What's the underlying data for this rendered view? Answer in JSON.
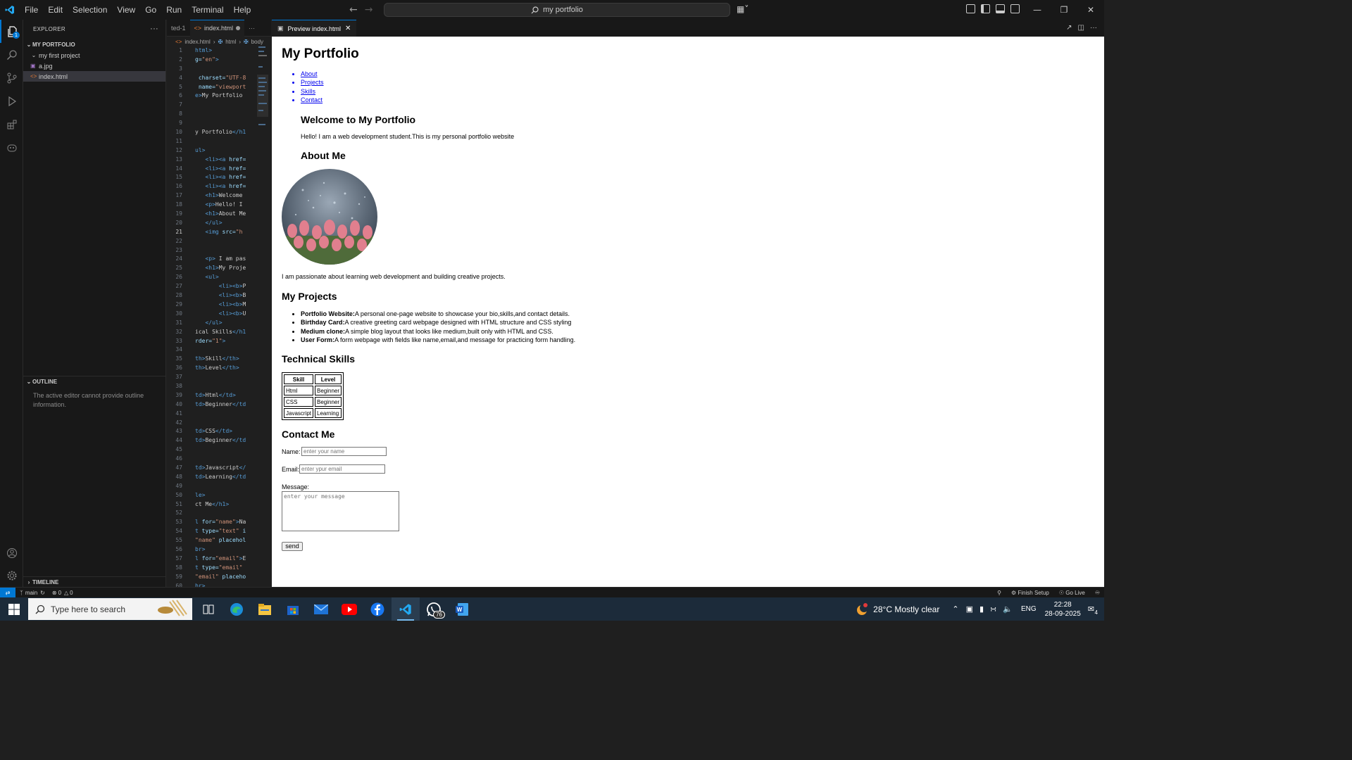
{
  "titlebar": {
    "menu": [
      "File",
      "Edit",
      "Selection",
      "View",
      "Go",
      "Run",
      "Terminal",
      "Help"
    ],
    "search_text": "my portfolio"
  },
  "activity": {
    "explorer_badge": "1"
  },
  "sidebar": {
    "header": "EXPLORER",
    "root": "MY PORTFOLIO",
    "items": [
      {
        "label": "my first project",
        "type": "folder"
      },
      {
        "label": "a.jpg",
        "type": "image"
      },
      {
        "label": "index.html",
        "type": "html"
      }
    ],
    "outline_header": "OUTLINE",
    "outline_message": "The active editor cannot provide outline information.",
    "timeline_header": "TIMELINE"
  },
  "editor": {
    "tabs": [
      {
        "label": "ted-1"
      },
      {
        "label": "index.html"
      }
    ],
    "breadcrumb": [
      "index.html",
      "html",
      "body"
    ],
    "current_line": 21,
    "lines": [
      {
        "n": 1,
        "parts": [
          [
            "tag",
            "html>"
          ]
        ]
      },
      {
        "n": 2,
        "parts": [
          [
            "attr",
            "g="
          ],
          [
            "str",
            "\"en\""
          ],
          [
            "tag",
            ">"
          ]
        ]
      },
      {
        "n": 3,
        "parts": []
      },
      {
        "n": 4,
        "parts": [
          [
            "attr",
            " charset="
          ],
          [
            "str",
            "\"UTF-8"
          ]
        ]
      },
      {
        "n": 5,
        "parts": [
          [
            "attr",
            " name="
          ],
          [
            "str",
            "\"viewport"
          ]
        ]
      },
      {
        "n": 6,
        "parts": [
          [
            "tag",
            "e>"
          ],
          [
            "txt",
            "My Portfolio"
          ]
        ]
      },
      {
        "n": 7,
        "parts": []
      },
      {
        "n": 8,
        "parts": []
      },
      {
        "n": 9,
        "parts": []
      },
      {
        "n": 10,
        "parts": [
          [
            "txt",
            "y Portfolio"
          ],
          [
            "tag",
            "</h1"
          ]
        ]
      },
      {
        "n": 11,
        "parts": []
      },
      {
        "n": 12,
        "parts": [
          [
            "tag",
            "ul>"
          ]
        ]
      },
      {
        "n": 13,
        "parts": [
          [
            "tag",
            "   <li><a "
          ],
          [
            "attr",
            "href="
          ]
        ]
      },
      {
        "n": 14,
        "parts": [
          [
            "tag",
            "   <li><a "
          ],
          [
            "attr",
            "href="
          ]
        ]
      },
      {
        "n": 15,
        "parts": [
          [
            "tag",
            "   <li><a "
          ],
          [
            "attr",
            "href="
          ]
        ]
      },
      {
        "n": 16,
        "parts": [
          [
            "tag",
            "   <li><a "
          ],
          [
            "attr",
            "href="
          ]
        ]
      },
      {
        "n": 17,
        "parts": [
          [
            "tag",
            "   <h1>"
          ],
          [
            "txt",
            "Welcome"
          ]
        ]
      },
      {
        "n": 18,
        "parts": [
          [
            "tag",
            "   <p>"
          ],
          [
            "txt",
            "Hello! I"
          ]
        ]
      },
      {
        "n": 19,
        "parts": [
          [
            "tag",
            "   <h1>"
          ],
          [
            "txt",
            "About Me"
          ]
        ]
      },
      {
        "n": 20,
        "parts": [
          [
            "tag",
            "   </ul>"
          ]
        ]
      },
      {
        "n": 21,
        "parts": [
          [
            "tag",
            "   <img "
          ],
          [
            "attr",
            "src="
          ],
          [
            "str",
            "\"h"
          ]
        ]
      },
      {
        "n": 22,
        "parts": []
      },
      {
        "n": 23,
        "parts": []
      },
      {
        "n": 24,
        "parts": [
          [
            "tag",
            "   <p>"
          ],
          [
            "txt",
            " I am pas"
          ]
        ]
      },
      {
        "n": 25,
        "parts": [
          [
            "tag",
            "   <h1>"
          ],
          [
            "txt",
            "My Proje"
          ]
        ]
      },
      {
        "n": 26,
        "parts": [
          [
            "tag",
            "   <ul>"
          ]
        ]
      },
      {
        "n": 27,
        "parts": [
          [
            "tag",
            "       <li><b>"
          ],
          [
            "txt",
            "P"
          ]
        ]
      },
      {
        "n": 28,
        "parts": [
          [
            "tag",
            "       <li><b>"
          ],
          [
            "txt",
            "B"
          ]
        ]
      },
      {
        "n": 29,
        "parts": [
          [
            "tag",
            "       <li><b>"
          ],
          [
            "txt",
            "M"
          ]
        ]
      },
      {
        "n": 30,
        "parts": [
          [
            "tag",
            "       <li><b>"
          ],
          [
            "txt",
            "U"
          ]
        ]
      },
      {
        "n": 31,
        "parts": [
          [
            "tag",
            "   </ul>"
          ]
        ]
      },
      {
        "n": 32,
        "parts": [
          [
            "txt",
            "ical Skills"
          ],
          [
            "tag",
            "</h1"
          ]
        ]
      },
      {
        "n": 33,
        "parts": [
          [
            "attr",
            "rder="
          ],
          [
            "str",
            "\"1\""
          ],
          [
            "tag",
            ">"
          ]
        ]
      },
      {
        "n": 34,
        "parts": []
      },
      {
        "n": 35,
        "parts": [
          [
            "tag",
            "th>"
          ],
          [
            "txt",
            "Skill"
          ],
          [
            "tag",
            "</th>"
          ]
        ]
      },
      {
        "n": 36,
        "parts": [
          [
            "tag",
            "th>"
          ],
          [
            "txt",
            "Level"
          ],
          [
            "tag",
            "</th>"
          ]
        ]
      },
      {
        "n": 37,
        "parts": []
      },
      {
        "n": 38,
        "parts": []
      },
      {
        "n": 39,
        "parts": [
          [
            "tag",
            "td>"
          ],
          [
            "txt",
            "Html"
          ],
          [
            "tag",
            "</td>"
          ]
        ]
      },
      {
        "n": 40,
        "parts": [
          [
            "tag",
            "td>"
          ],
          [
            "txt",
            "Beginner"
          ],
          [
            "tag",
            "</td"
          ]
        ]
      },
      {
        "n": 41,
        "parts": []
      },
      {
        "n": 42,
        "parts": []
      },
      {
        "n": 43,
        "parts": [
          [
            "tag",
            "td>"
          ],
          [
            "txt",
            "CSS"
          ],
          [
            "tag",
            "</td>"
          ]
        ]
      },
      {
        "n": 44,
        "parts": [
          [
            "tag",
            "td>"
          ],
          [
            "txt",
            "Beginner"
          ],
          [
            "tag",
            "</td"
          ]
        ]
      },
      {
        "n": 45,
        "parts": []
      },
      {
        "n": 46,
        "parts": []
      },
      {
        "n": 47,
        "parts": [
          [
            "tag",
            "td>"
          ],
          [
            "txt",
            "Javascript"
          ],
          [
            "tag",
            "</"
          ]
        ]
      },
      {
        "n": 48,
        "parts": [
          [
            "tag",
            "td>"
          ],
          [
            "txt",
            "Learning"
          ],
          [
            "tag",
            "</td"
          ]
        ]
      },
      {
        "n": 49,
        "parts": []
      },
      {
        "n": 50,
        "parts": [
          [
            "tag",
            "le>"
          ]
        ]
      },
      {
        "n": 51,
        "parts": [
          [
            "txt",
            "ct Me"
          ],
          [
            "tag",
            "</h1>"
          ]
        ]
      },
      {
        "n": 52,
        "parts": []
      },
      {
        "n": 53,
        "parts": [
          [
            "tag",
            "l "
          ],
          [
            "attr",
            "for="
          ],
          [
            "str",
            "\"name\""
          ],
          [
            "tag",
            ">"
          ],
          [
            "txt",
            "Na"
          ]
        ]
      },
      {
        "n": 54,
        "parts": [
          [
            "tag",
            "t "
          ],
          [
            "attr",
            "type="
          ],
          [
            "str",
            "\"text\""
          ],
          [
            "attr",
            " i"
          ]
        ]
      },
      {
        "n": 55,
        "parts": [
          [
            "str",
            "\"name\""
          ],
          [
            "attr",
            " placehol"
          ]
        ]
      },
      {
        "n": 56,
        "parts": [
          [
            "tag",
            "br>"
          ]
        ]
      },
      {
        "n": 57,
        "parts": [
          [
            "tag",
            "l "
          ],
          [
            "attr",
            "for="
          ],
          [
            "str",
            "\"email\""
          ],
          [
            "tag",
            ">"
          ],
          [
            "txt",
            "E"
          ]
        ]
      },
      {
        "n": 58,
        "parts": [
          [
            "tag",
            "t "
          ],
          [
            "attr",
            "type="
          ],
          [
            "str",
            "\"email\""
          ]
        ]
      },
      {
        "n": 59,
        "parts": [
          [
            "str",
            "\"email\""
          ],
          [
            "attr",
            " placeho"
          ]
        ]
      },
      {
        "n": 60,
        "parts": [
          [
            "tag",
            "br>"
          ]
        ]
      }
    ]
  },
  "preview": {
    "tab_label": "Preview index.html",
    "title": "My Portfolio",
    "nav": [
      "About",
      "Projects",
      "Skills",
      "Contact"
    ],
    "welcome_heading": "Welcome to My Portfolio",
    "welcome_text": "Hello! I am a web development student.This is my personal portfolio website",
    "about_heading": "About Me",
    "about_text": "I am passionate about learning web development and building creative projects.",
    "projects_heading": "My Projects",
    "projects": [
      {
        "name": "Portfolio Website:",
        "desc": "A personal one-page website to showcase your bio,skills,and contact details."
      },
      {
        "name": "Birthday Card:",
        "desc": "A creative greeting card webpage designed with HTML structure and CSS styling"
      },
      {
        "name": "Medium clone:",
        "desc": "A simple blog layout that looks like medium,built only with HTML and CSS."
      },
      {
        "name": "User Form:",
        "desc": "A form webpage with fields like name,email,and message for practicing form handling."
      }
    ],
    "skills_heading": "Technical Skills",
    "skills_headers": [
      "Skill",
      "Level"
    ],
    "skills_rows": [
      [
        "Html",
        "Beginner"
      ],
      [
        "CSS",
        "Beginner"
      ],
      [
        "Javascript",
        "Learning"
      ]
    ],
    "contact_heading": "Contact Me",
    "name_label": "Name:",
    "name_placeholder": "enter your name",
    "email_label": "Email:",
    "email_placeholder": "enter ypur email",
    "message_label": "Message:",
    "message_placeholder": "enter your message",
    "send_label": "send"
  },
  "statusbar": {
    "branch": "main",
    "problems": "0",
    "warnings": "0",
    "finish_setup": "Finish Setup",
    "go_live": "Go Live"
  },
  "taskbar": {
    "search_placeholder": "Type here to search",
    "whatsapp_badge": "76",
    "weather": "28°C  Mostly clear",
    "language": "ENG",
    "time": "22:28",
    "date": "28-09-2025",
    "notif_count": "4"
  },
  "colors": {
    "accent": "#0078d4",
    "link": "#0000ee"
  }
}
